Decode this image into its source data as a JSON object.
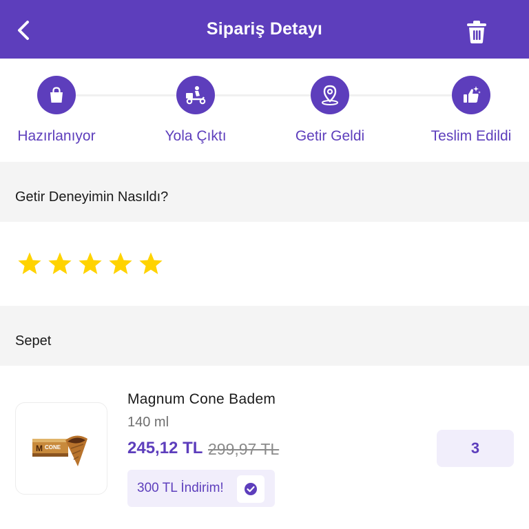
{
  "header": {
    "title": "Sipariş Detayı",
    "back_icon": "chevron-left-icon",
    "delete_icon": "trash-icon"
  },
  "order_status": {
    "steps": [
      {
        "label": "Hazırlanıyor",
        "icon": "shopping-bag-icon"
      },
      {
        "label": "Yola Çıktı",
        "icon": "courier-scooter-icon"
      },
      {
        "label": "Getir Geldi",
        "icon": "location-pin-icon"
      },
      {
        "label": "Teslim Edildi",
        "icon": "thumbs-up-sparkle-icon"
      }
    ]
  },
  "rating": {
    "question": "Getir Deneyimin Nasıldı?",
    "stars": 5,
    "max_stars": 5
  },
  "basket": {
    "title": "Sepet",
    "items": [
      {
        "name": "Magnum Cone Badem",
        "size": "140 ml",
        "price": "245,12 TL",
        "old_price": "299,97 TL",
        "promo": "300 TL İndirim!",
        "promo_applied": true,
        "quantity": "3",
        "image_text": "CONE"
      }
    ]
  },
  "colors": {
    "brand": "#5d3ebc",
    "star": "#ffd300",
    "promo_bg": "#f1eefb",
    "section_bg": "#f4f4f4"
  }
}
